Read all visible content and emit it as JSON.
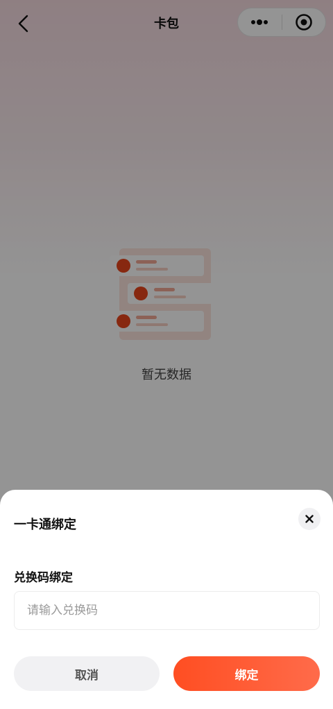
{
  "header": {
    "title": "卡包"
  },
  "empty_state": {
    "text": "暂无数据"
  },
  "sheet": {
    "title": "一卡通绑定",
    "field_label": "兑换码绑定",
    "input_placeholder": "请输入兑换码",
    "input_value": "",
    "cancel_label": "取消",
    "bind_label": "绑定"
  },
  "colors": {
    "accent": "#ff5330",
    "illustration_dot": "#e8461c",
    "illustration_bar": "#f2c1b4"
  },
  "icons": {
    "back": "chevron-left-icon",
    "more": "more-dots-icon",
    "target": "target-icon",
    "close": "close-icon"
  }
}
